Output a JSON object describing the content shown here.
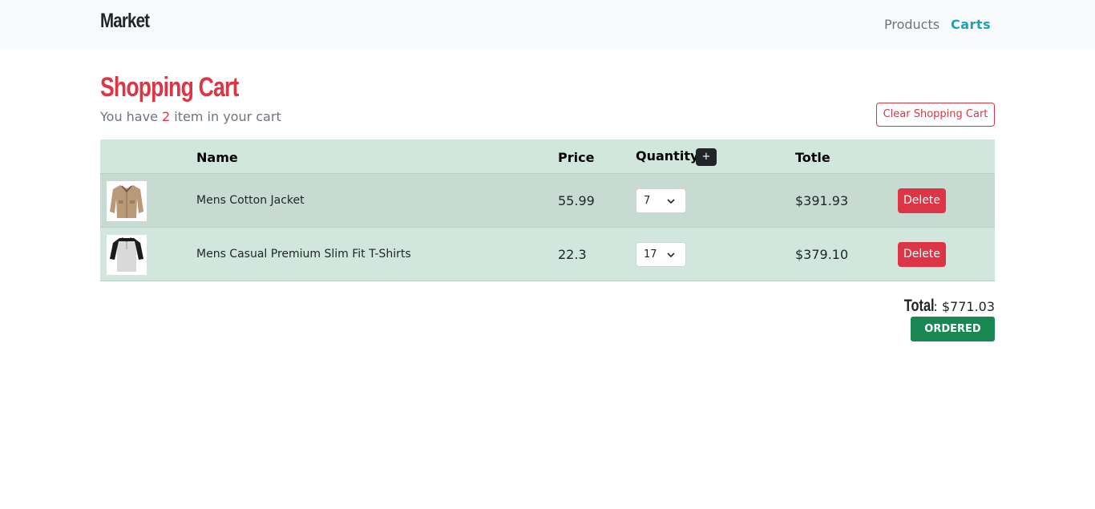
{
  "nav": {
    "brand": "Market",
    "links": [
      {
        "label": "Products",
        "active": false
      },
      {
        "label": "Carts",
        "active": true
      }
    ]
  },
  "cart": {
    "title": "Shopping Cart",
    "subtitle_prefix": "You have ",
    "item_count": "2",
    "subtitle_suffix": " item in your cart",
    "clear_label": "Clear Shopping Cart",
    "headers": {
      "name": "Name",
      "price": "Price",
      "quantity": "Quantity",
      "add": "+",
      "total": "Totle"
    },
    "rows": [
      {
        "icon": "jacket-thumbnail",
        "name": "Mens Cotton Jacket",
        "price": "55.99",
        "quantity": "7",
        "total": "$391.93",
        "delete_label": "Delete"
      },
      {
        "icon": "tshirt-thumbnail",
        "name": "Mens Casual Premium Slim Fit T-Shirts",
        "price": "22.3",
        "quantity": "17",
        "total": "$379.10",
        "delete_label": "Delete"
      }
    ],
    "total_label": "Total",
    "total_sep": " : ",
    "total_value": "$771.03",
    "order_label": "ORDERED"
  },
  "colors": {
    "accent": "#dc3545",
    "nav_active": "#17a2b8",
    "table_bg": "#d1e7dd",
    "order": "#198754"
  }
}
